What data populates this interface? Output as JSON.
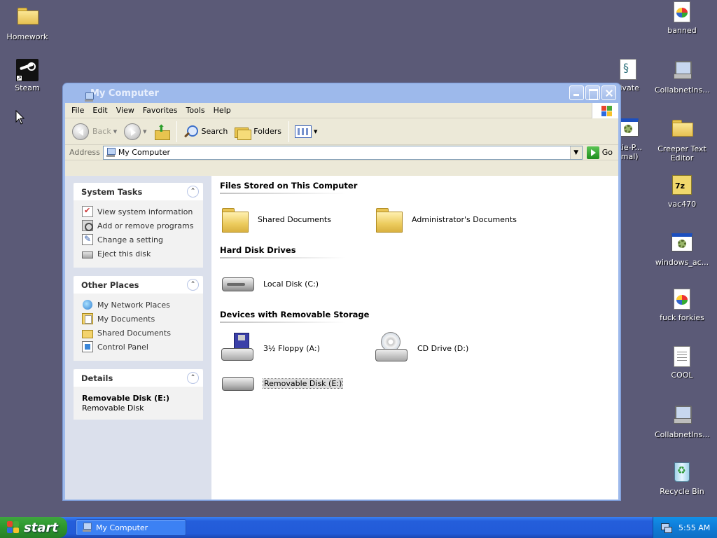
{
  "desktop": {
    "icons_left": [
      {
        "label": "Homework",
        "icon": "folder-icon"
      },
      {
        "label": "Steam",
        "icon": "steam-icon"
      }
    ],
    "icons_right": [
      {
        "label": "banned",
        "icon": "image-file-icon"
      },
      {
        "label": "tivate",
        "icon": "script-file-icon"
      },
      {
        "label": "CollabnetIns...",
        "icon": "computer-icon"
      },
      {
        "label": "rkie-P...",
        "label2": "rmal)",
        "icon": "program-icon"
      },
      {
        "label": "Creeper Text Editor",
        "icon": "folder-icon"
      },
      {
        "label": "vac470",
        "icon": "archive-icon"
      },
      {
        "label": "windows_ac...",
        "icon": "program-icon"
      },
      {
        "label": "fuck forkies",
        "icon": "image-file-icon"
      },
      {
        "label": "COOL",
        "icon": "text-file-icon"
      },
      {
        "label": "CollabnetIns...",
        "icon": "computer-icon"
      },
      {
        "label": "Recycle Bin",
        "icon": "recycle-bin-icon"
      }
    ]
  },
  "window": {
    "title": "My Computer",
    "menu": [
      "File",
      "Edit",
      "View",
      "Favorites",
      "Tools",
      "Help"
    ],
    "toolbar": {
      "back": "Back",
      "search": "Search",
      "folders": "Folders"
    },
    "address": {
      "label": "Address",
      "value": "My Computer",
      "go": "Go"
    },
    "system_tasks": {
      "title": "System Tasks",
      "items": [
        "View system information",
        "Add or remove programs",
        "Change a setting",
        "Eject this disk"
      ]
    },
    "other_places": {
      "title": "Other Places",
      "items": [
        "My Network Places",
        "My Documents",
        "Shared Documents",
        "Control Panel"
      ]
    },
    "details": {
      "title": "Details",
      "name": "Removable Disk (E:)",
      "type": "Removable Disk"
    },
    "groups": {
      "files": {
        "title": "Files Stored on This Computer",
        "items": [
          "Shared Documents",
          "Administrator's Documents"
        ]
      },
      "hard_disks": {
        "title": "Hard Disk Drives",
        "items": [
          "Local Disk (C:)"
        ]
      },
      "removable": {
        "title": "Devices with Removable Storage",
        "items": [
          "3½ Floppy (A:)",
          "CD Drive (D:)",
          "Removable Disk (E:)"
        ]
      }
    }
  },
  "taskbar": {
    "start": "start",
    "task_button": "My Computer",
    "clock": "5:55 AM"
  }
}
